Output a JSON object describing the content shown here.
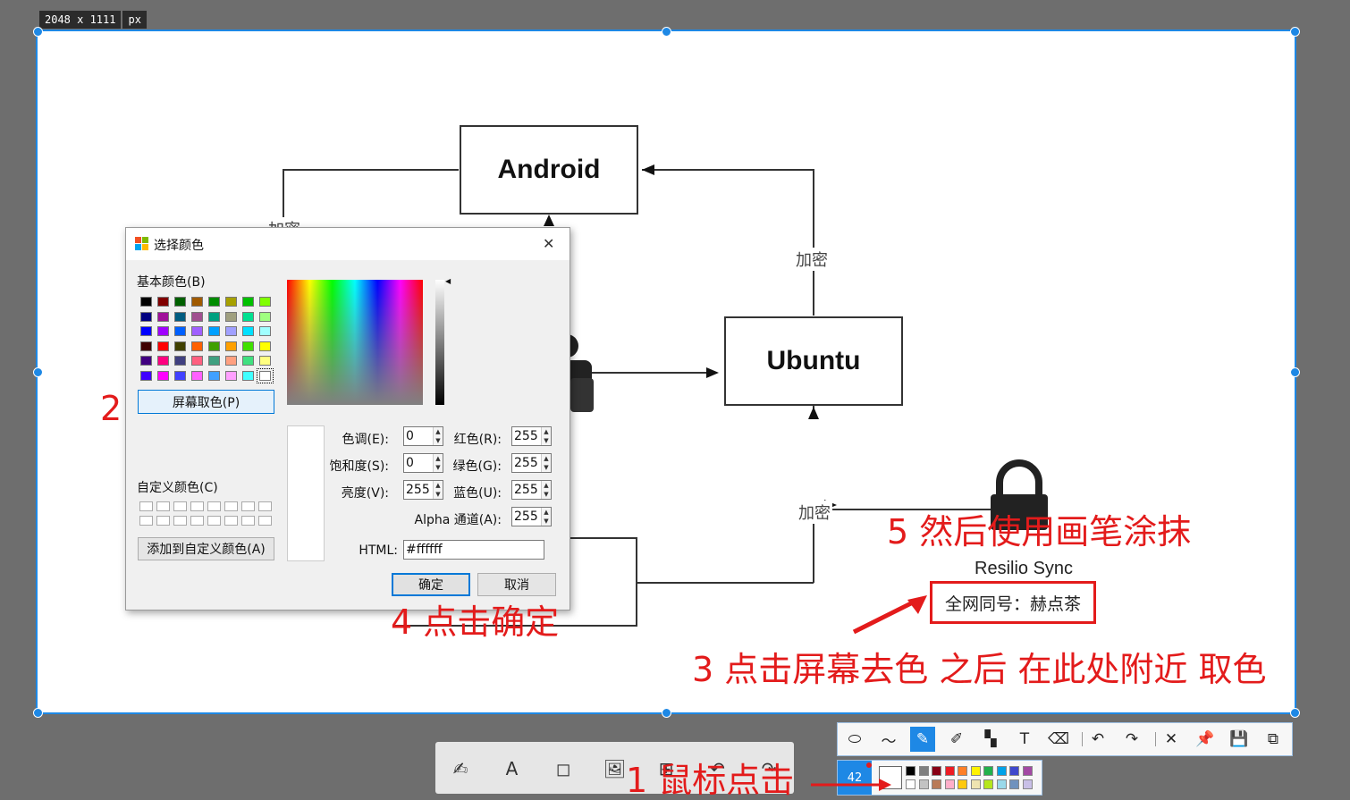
{
  "size_badge": {
    "dimensions": "2048 x 1111",
    "unit": "px"
  },
  "diagram": {
    "android": "Android",
    "ubuntu": "Ubuntu",
    "encrypt_label": "加密",
    "resilio_title": "Resilio Sync",
    "resilio_sub": "全网同号：赫点茶",
    "accent": "#e31b1b"
  },
  "dialog": {
    "title": "选择颜色",
    "close": "✕",
    "basic_colors_label": "基本颜色(B)",
    "basic_colors": [
      [
        "#000000",
        "#800000",
        "#006000",
        "#a05a00",
        "#008c00",
        "#a6a000",
        "#00c000",
        "#80ff00"
      ],
      [
        "#000080",
        "#a0109a",
        "#005c80",
        "#a05090",
        "#00a080",
        "#a0a080",
        "#00e090",
        "#a0ff80"
      ],
      [
        "#0000ff",
        "#a000ff",
        "#0060ff",
        "#a060ff",
        "#00a0ff",
        "#a0a0ff",
        "#00e0ff",
        "#a0ffff"
      ],
      [
        "#400000",
        "#ff0000",
        "#404000",
        "#ff6000",
        "#40a000",
        "#ffa000",
        "#40e000",
        "#ffff00"
      ],
      [
        "#400080",
        "#ff0080",
        "#404080",
        "#ff6080",
        "#40a080",
        "#ffa080",
        "#40e080",
        "#ffff80"
      ],
      [
        "#4000ff",
        "#ff00ff",
        "#4040ff",
        "#ff60ff",
        "#40a0ff",
        "#ffa0ff",
        "#40ffff",
        "#ffffff"
      ]
    ],
    "screen_pick_button": "屏幕取色(P)",
    "custom_colors_label": "自定义颜色(C)",
    "add_custom_button": "添加到自定义颜色(A)",
    "fields": {
      "hue_label": "色调(E):",
      "hue": "0",
      "sat_label": "饱和度(S):",
      "sat": "0",
      "lum_label": "亮度(V):",
      "lum": "255",
      "red_label": "红色(R):",
      "red": "255",
      "green_label": "绿色(G):",
      "green": "255",
      "blue_label": "蓝色(U):",
      "blue": "255",
      "alpha_label": "Alpha 通道(A):",
      "alpha": "255",
      "html_label": "HTML:",
      "html": "#ffffff"
    },
    "ok_button": "确定",
    "cancel_button": "取消"
  },
  "annotations": {
    "step1": "1 鼠标点击",
    "step2": "2",
    "step3": "3 点击屏幕去色 之后 在此处附近 取色",
    "step4": "4 点击确定",
    "step5": "5 然后使用画笔涂抹"
  },
  "bottom_toolbar": {
    "icons": [
      "signature-icon",
      "text-icon",
      "shape-icon",
      "image-icon",
      "add-icon",
      "undo-icon",
      "redo-icon"
    ],
    "glyphs": [
      "✍",
      "A",
      "◻",
      "🖼",
      "⊞",
      "↶",
      "↷"
    ]
  },
  "draw_toolbar": {
    "icons": [
      "shape-icon",
      "polyline-icon",
      "pen-icon",
      "marker-icon",
      "mosaic-icon",
      "text-icon",
      "eraser-icon",
      "undo-icon",
      "redo-icon",
      "close-icon",
      "pin-icon",
      "save-icon",
      "copy-icon"
    ],
    "glyphs": [
      "⬭",
      "〜",
      "✎",
      "✐",
      "▚",
      "T",
      "⌫",
      "↶",
      "↷",
      "✕",
      "📌",
      "💾",
      "⧉"
    ]
  },
  "pen_panel": {
    "size": "42",
    "palette_top": [
      "#000000",
      "#7f7f7f",
      "#880015",
      "#ed1c24",
      "#ff7f27",
      "#fff200",
      "#22b14c",
      "#00a2e8",
      "#3f48cc",
      "#a349a4"
    ],
    "palette_bottom": [
      "#ffffff",
      "#c3c3c3",
      "#b97a57",
      "#ffaec9",
      "#ffc90e",
      "#efe4b0",
      "#b5e61d",
      "#99d9ea",
      "#7092be",
      "#c8bfe7"
    ]
  }
}
